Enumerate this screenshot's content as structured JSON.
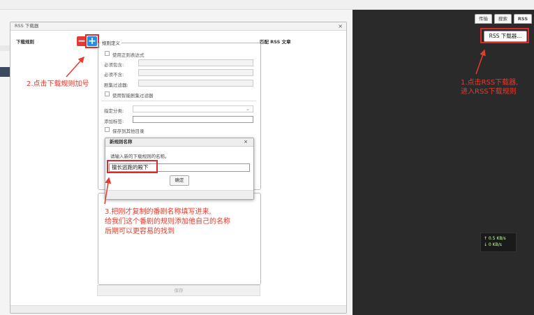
{
  "top_tabs": [
    "传输",
    "搜索",
    "RSS"
  ],
  "rss_downloader_button": "RSS 下载器...",
  "window": {
    "title": "RSS 下载器",
    "close": "×",
    "rules_header": "下载规则",
    "rule_definition_legend": "规则定义",
    "match_header": "匹配 RSS 文章",
    "use_regex": "使用正则表达式",
    "must_contain": "必须包含:",
    "must_not_contain": "必须不含:",
    "episode_filter": "剧集过滤器:",
    "smart_episode_filter": "使用智能剧集过滤器",
    "assign_category": "指定分类:",
    "add_tags": "添加标签:",
    "save_to_other_dir": "保存到其他目录",
    "save_button": "保存",
    "remove_icon": "−",
    "add_icon": "+"
  },
  "dialog": {
    "title": "新规则名称",
    "close": "×",
    "message": "请输入新的下载规则的名称。",
    "input_value": "擅长逃跑的殿下",
    "ok": "确定"
  },
  "annotations": {
    "step1_line1": "1.点击RSS下载器,",
    "step1_line2": "进入RSS下载规则",
    "step2": "2.点击下载规则加号",
    "step3_line1": "3.把刚才复制的番剧名称填写进来,",
    "step3_line2": "给我们这个番剧的规则添加他自己的名称",
    "step3_line3": "后期可以更容易的找到"
  },
  "speed": {
    "up": "↑ 0.5 KB/s",
    "down": "↓ 0 KB/s"
  },
  "colors": {
    "annotation_red": "#e33d2e",
    "add_button_blue": "#1e90e6",
    "remove_button_red": "#e53935"
  }
}
